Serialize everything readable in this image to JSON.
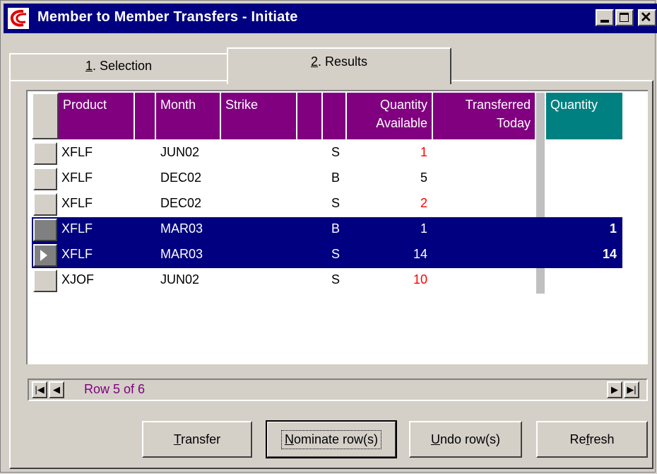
{
  "window": {
    "title": "Member to Member Transfers - Initiate",
    "controls": {
      "minimize": "_",
      "maximize": "□",
      "close": "✕"
    }
  },
  "tabs": [
    {
      "key": "1",
      "label": ". Selection",
      "active": false
    },
    {
      "key": "2",
      "label": ". Results",
      "active": true
    }
  ],
  "grid": {
    "headers": {
      "product": "Product",
      "month": "Month",
      "strike": "Strike",
      "qty_available_1": "Quantity",
      "qty_available_2": "Available",
      "transferred_1": "Transferred",
      "transferred_2": "Today",
      "quantity": "Quantity"
    },
    "rows": [
      {
        "product": "XFLF",
        "month": "JUN02",
        "side": "S",
        "available": "1",
        "available_color": "#ff0000",
        "quantity": "",
        "selected": false,
        "current": false
      },
      {
        "product": "XFLF",
        "month": "DEC02",
        "side": "B",
        "available": "5",
        "available_color": "#000000",
        "quantity": "",
        "selected": false,
        "current": false
      },
      {
        "product": "XFLF",
        "month": "DEC02",
        "side": "S",
        "available": "2",
        "available_color": "#ff0000",
        "quantity": "",
        "selected": false,
        "current": false
      },
      {
        "product": "XFLF",
        "month": "MAR03",
        "side": "B",
        "available": "1",
        "available_color": "#ffffff",
        "quantity": "1",
        "selected": true,
        "current": false
      },
      {
        "product": "XFLF",
        "month": "MAR03",
        "side": "S",
        "available": "14",
        "available_color": "#ffffff",
        "quantity": "14",
        "selected": true,
        "current": true
      },
      {
        "product": "XJOF",
        "month": "JUN02",
        "side": "S",
        "available": "10",
        "available_color": "#ff0000",
        "quantity": "",
        "selected": false,
        "current": false
      }
    ]
  },
  "navigator": {
    "status": "Row 5 of 6",
    "icons": [
      "first-record-icon",
      "prev-record-icon",
      "next-record-icon",
      "last-record-icon"
    ]
  },
  "buttons": {
    "transfer": {
      "mnemonic": "T",
      "rest": "ransfer"
    },
    "nominate": {
      "mnemonic": "N",
      "rest": "ominate row(s)"
    },
    "undo": {
      "mnemonic": "U",
      "rest": "ndo row(s)"
    },
    "refresh": {
      "pre": "Re",
      "mnemonic": "f",
      "rest": "resh"
    }
  },
  "colors": {
    "title_bar": "#000080",
    "header_purple": "#800080",
    "header_teal": "#008080",
    "selection": "#000080",
    "warning_red": "#ff0000",
    "face": "#d4d0c8"
  }
}
